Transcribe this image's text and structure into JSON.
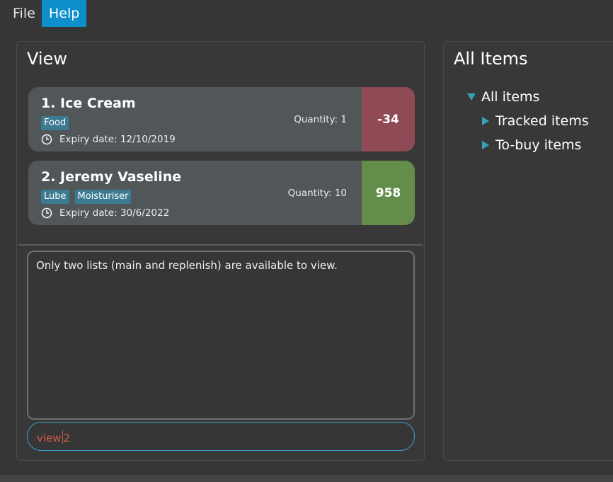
{
  "menu": {
    "file": "File",
    "help": "Help"
  },
  "view_panel": {
    "title": "View",
    "items": [
      {
        "name": "1.  Ice Cream",
        "tags": [
          "Food"
        ],
        "expiry": "Expiry date: 12/10/2019",
        "quantity": "Quantity: 1",
        "count": "-34",
        "count_color": "#8f4a55"
      },
      {
        "name": "2.  Jeremy Vaseline",
        "tags": [
          "Lube",
          "Moisturiser"
        ],
        "expiry": "Expiry date: 30/6/2022",
        "quantity": "Quantity: 10",
        "count": "958",
        "count_color": "#648c4a"
      }
    ],
    "result_message": "Only two lists (main and replenish) are available to view.",
    "command": {
      "before_caret": "view",
      "after_caret": "2"
    }
  },
  "tree_panel": {
    "title": "All Items",
    "root": "All items",
    "children": [
      "Tracked items",
      "To-buy items"
    ]
  },
  "colors": {
    "accent": "#0d8fcc",
    "tag": "#3b7a91",
    "tree_triangle": "#34a3b5"
  }
}
